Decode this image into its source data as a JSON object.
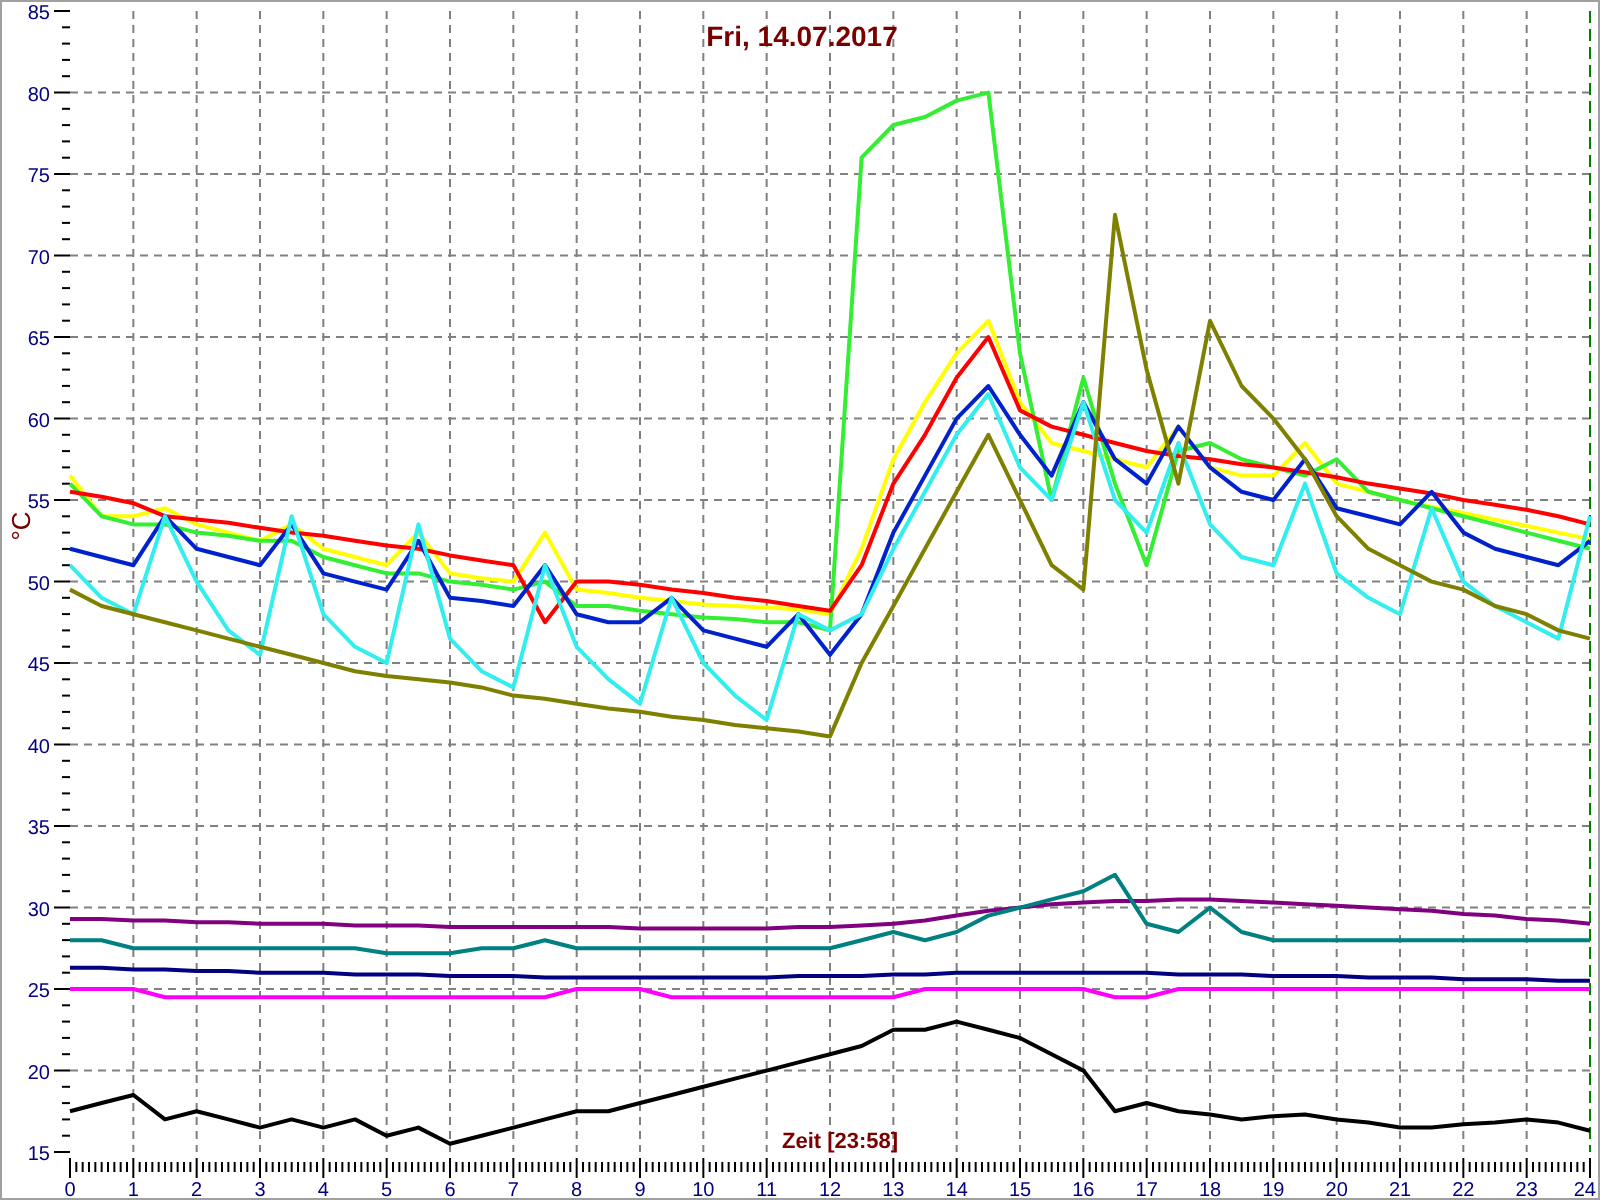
{
  "chart": {
    "chart_data": {
      "type": "line",
      "grid": true,
      "title": "Fri, 14.07.2017",
      "xlabel": "Zeit [23:58]",
      "ylabel": "°C",
      "x": [
        0,
        0.5,
        1,
        1.5,
        2,
        2.5,
        3,
        3.5,
        4,
        4.5,
        5,
        5.5,
        6,
        6.5,
        7,
        7.5,
        8,
        8.5,
        9,
        9.5,
        10,
        10.5,
        11,
        11.5,
        12,
        12.5,
        13,
        13.5,
        14,
        14.5,
        15,
        15.5,
        16,
        16.5,
        17,
        17.5,
        18,
        18.5,
        19,
        19.5,
        20,
        20.5,
        21,
        21.5,
        22,
        22.5,
        23,
        23.5,
        24
      ],
      "xlim": [
        0,
        24
      ],
      "ylim": [
        15,
        85
      ],
      "xticks": [
        0,
        1,
        2,
        3,
        4,
        5,
        6,
        7,
        8,
        9,
        10,
        11,
        12,
        13,
        14,
        15,
        16,
        17,
        18,
        19,
        20,
        21,
        22,
        23,
        24
      ],
      "yticks": [
        15,
        20,
        25,
        30,
        35,
        40,
        45,
        50,
        55,
        60,
        65,
        70,
        75,
        80,
        85
      ],
      "series": [
        {
          "color": "#ffff00",
          "values": [
            56.5,
            54,
            54,
            54.5,
            53.5,
            53,
            52.5,
            53.5,
            52,
            51.5,
            51,
            53,
            50.5,
            50.2,
            50,
            53,
            49.5,
            49.3,
            49,
            48.8,
            48.6,
            48.5,
            48.4,
            48.3,
            48,
            52,
            57.5,
            61,
            64,
            66,
            61,
            58.5,
            58,
            57.5,
            57,
            59.5,
            57,
            56.5,
            56.5,
            58.5,
            56,
            55.5,
            55,
            54.6,
            54.2,
            53.8,
            53.4,
            53,
            52.6
          ]
        },
        {
          "color": "#33ee33",
          "values": [
            56,
            54,
            53.5,
            53.5,
            53,
            52.8,
            52.5,
            52.5,
            51.5,
            51,
            50.5,
            50.5,
            50,
            49.8,
            49.5,
            50,
            48.5,
            48.5,
            48.2,
            48,
            47.8,
            47.7,
            47.5,
            47.5,
            47,
            76,
            78,
            78.5,
            79.5,
            80,
            64,
            55,
            62.5,
            56,
            51,
            58,
            58.5,
            57.5,
            57,
            56.5,
            57.5,
            55.5,
            55,
            54.5,
            54,
            53.5,
            53,
            52.5,
            52
          ]
        },
        {
          "color": "#ff0000",
          "values": [
            55.5,
            55.2,
            54.8,
            54,
            53.8,
            53.6,
            53.3,
            53,
            52.8,
            52.5,
            52.2,
            52,
            51.6,
            51.3,
            51,
            47.5,
            50,
            50,
            49.8,
            49.5,
            49.3,
            49,
            48.8,
            48.5,
            48.2,
            51,
            56,
            59,
            62.5,
            65,
            60.5,
            59.5,
            59,
            58.5,
            58,
            57.7,
            57.5,
            57.2,
            57,
            56.7,
            56.4,
            56,
            55.7,
            55.4,
            55,
            54.7,
            54.4,
            54,
            53.5
          ]
        },
        {
          "color": "#0022cc",
          "values": [
            52,
            51.5,
            51,
            54,
            52,
            51.5,
            51,
            53.5,
            50.5,
            50,
            49.5,
            52.5,
            49,
            48.8,
            48.5,
            51,
            48,
            47.5,
            47.5,
            49,
            47,
            46.5,
            46,
            48,
            45.5,
            48,
            53,
            56.5,
            60,
            62,
            59,
            56.5,
            61,
            57.5,
            56,
            59.5,
            57,
            55.5,
            55,
            57.5,
            54.5,
            54,
            53.5,
            55.5,
            53,
            52,
            51.5,
            51,
            52.5
          ]
        },
        {
          "color": "#33eeee",
          "values": [
            51,
            49,
            48,
            54,
            50,
            47,
            45.5,
            54,
            48,
            46,
            45,
            53.5,
            46.5,
            44.5,
            43.5,
            51,
            46,
            44,
            42.5,
            49,
            45,
            43,
            41.5,
            48,
            47,
            48,
            52,
            55.5,
            59,
            61.5,
            57,
            55,
            61,
            55,
            53,
            58.5,
            53.5,
            51.5,
            51,
            56,
            50.5,
            49,
            48,
            54.5,
            50,
            48.5,
            47.5,
            46.5,
            54
          ]
        },
        {
          "color": "#808000",
          "values": [
            49.5,
            48.5,
            48,
            47.5,
            47,
            46.5,
            46,
            45.5,
            45,
            44.5,
            44.2,
            44,
            43.8,
            43.5,
            43,
            42.8,
            42.5,
            42.2,
            42,
            41.7,
            41.5,
            41.2,
            41,
            40.8,
            40.5,
            45,
            48.5,
            52,
            55.5,
            59,
            55,
            51,
            49.5,
            72.5,
            63,
            56,
            66,
            62,
            60,
            57.5,
            54,
            52,
            51,
            50,
            49.5,
            48.5,
            48,
            47,
            46.5
          ]
        },
        {
          "color": "#800080",
          "values": [
            29.3,
            29.3,
            29.2,
            29.2,
            29.1,
            29.1,
            29,
            29,
            29,
            28.9,
            28.9,
            28.9,
            28.8,
            28.8,
            28.8,
            28.8,
            28.8,
            28.8,
            28.7,
            28.7,
            28.7,
            28.7,
            28.7,
            28.8,
            28.8,
            28.9,
            29,
            29.2,
            29.5,
            29.8,
            30,
            30.2,
            30.3,
            30.4,
            30.4,
            30.5,
            30.5,
            30.4,
            30.3,
            30.2,
            30.1,
            30,
            29.9,
            29.8,
            29.6,
            29.5,
            29.3,
            29.2,
            29
          ]
        },
        {
          "color": "#008080",
          "values": [
            28,
            28,
            27.5,
            27.5,
            27.5,
            27.5,
            27.5,
            27.5,
            27.5,
            27.5,
            27.2,
            27.2,
            27.2,
            27.5,
            27.5,
            28,
            27.5,
            27.5,
            27.5,
            27.5,
            27.5,
            27.5,
            27.5,
            27.5,
            27.5,
            28,
            28.5,
            28,
            28.5,
            29.5,
            30,
            30.5,
            31,
            32,
            29,
            28.5,
            30,
            28.5,
            28,
            28,
            28,
            28,
            28,
            28,
            28,
            28,
            28,
            28,
            28
          ]
        },
        {
          "color": "#000080",
          "values": [
            26.3,
            26.3,
            26.2,
            26.2,
            26.1,
            26.1,
            26,
            26,
            26,
            25.9,
            25.9,
            25.9,
            25.8,
            25.8,
            25.8,
            25.7,
            25.7,
            25.7,
            25.7,
            25.7,
            25.7,
            25.7,
            25.7,
            25.8,
            25.8,
            25.8,
            25.9,
            25.9,
            26,
            26,
            26,
            26,
            26,
            26,
            26,
            25.9,
            25.9,
            25.9,
            25.8,
            25.8,
            25.8,
            25.7,
            25.7,
            25.7,
            25.6,
            25.6,
            25.6,
            25.5,
            25.5
          ]
        },
        {
          "color": "#ff00ff",
          "values": [
            25,
            25,
            25,
            24.5,
            24.5,
            24.5,
            24.5,
            24.5,
            24.5,
            24.5,
            24.5,
            24.5,
            24.5,
            24.5,
            24.5,
            24.5,
            25,
            25,
            25,
            24.5,
            24.5,
            24.5,
            24.5,
            24.5,
            24.5,
            24.5,
            24.5,
            25,
            25,
            25,
            25,
            25,
            25,
            24.5,
            24.5,
            25,
            25,
            25,
            25,
            25,
            25,
            25,
            25,
            25,
            25,
            25,
            25,
            25,
            25
          ]
        },
        {
          "color": "#000000",
          "values": [
            17.5,
            18,
            18.5,
            17,
            17.5,
            17,
            16.5,
            17,
            16.5,
            17,
            16,
            16.5,
            15.5,
            16,
            16.5,
            17,
            17.5,
            17.5,
            18,
            18.5,
            19,
            19.5,
            20,
            20.5,
            21,
            21.5,
            22.5,
            22.5,
            23,
            22.5,
            22,
            21,
            20,
            17.5,
            18,
            17.5,
            17.3,
            17,
            17.2,
            17.3,
            17,
            16.8,
            16.5,
            16.5,
            16.7,
            16.8,
            17,
            16.8,
            16.3
          ]
        }
      ]
    }
  }
}
